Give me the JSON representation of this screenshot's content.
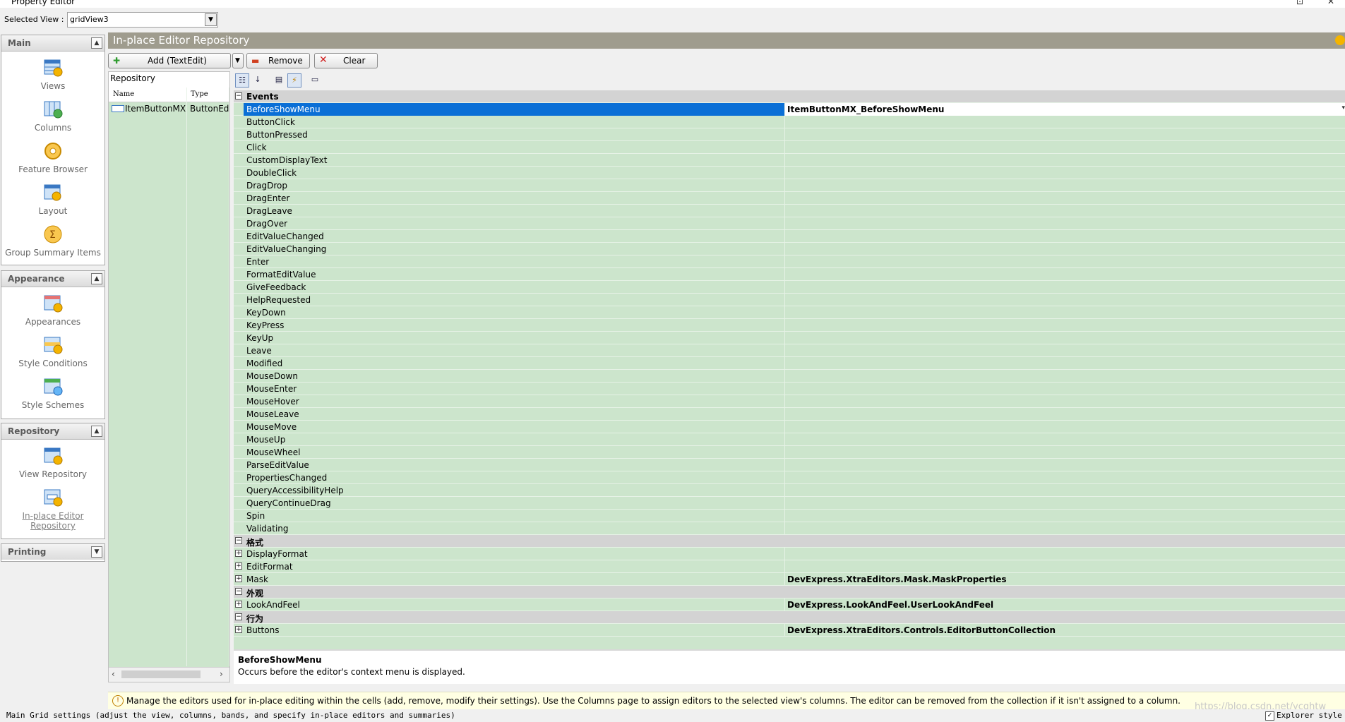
{
  "window": {
    "title": "Property Editor",
    "buttons": [
      "⊡",
      "✕"
    ]
  },
  "view_selector": {
    "label": "Selected View :",
    "value": "gridView3"
  },
  "nav": {
    "groups": [
      {
        "title": "Main",
        "items": [
          "Views",
          "Columns",
          "Feature Browser",
          "Layout",
          "Group Summary Items"
        ]
      },
      {
        "title": "Appearance",
        "items": [
          "Appearances",
          "Style Conditions",
          "Style Schemes"
        ]
      },
      {
        "title": "Repository",
        "items": [
          "View Repository",
          "In-place Editor",
          "Repository"
        ]
      },
      {
        "title": "Printing",
        "items": []
      }
    ]
  },
  "header": {
    "title": "In-place Editor Repository"
  },
  "toolbar": {
    "add_label": "Add (TextEdit)",
    "remove_label": "Remove",
    "clear_label": "Clear"
  },
  "repository": {
    "title": "Repository",
    "col_name": "Name",
    "col_type": "Type",
    "rows": [
      {
        "name": "ItemButtonMX",
        "type": "ButtonEdit"
      }
    ]
  },
  "grid": {
    "rows": [
      {
        "cat": true,
        "name": "Events"
      },
      {
        "name": "BeforeShowMenu",
        "value": "ItemButtonMX_BeforeShowMenu",
        "selected": true
      },
      {
        "name": "ButtonClick"
      },
      {
        "name": "ButtonPressed"
      },
      {
        "name": "Click"
      },
      {
        "name": "CustomDisplayText"
      },
      {
        "name": "DoubleClick"
      },
      {
        "name": "DragDrop"
      },
      {
        "name": "DragEnter"
      },
      {
        "name": "DragLeave"
      },
      {
        "name": "DragOver"
      },
      {
        "name": "EditValueChanged"
      },
      {
        "name": "EditValueChanging"
      },
      {
        "name": "Enter"
      },
      {
        "name": "FormatEditValue"
      },
      {
        "name": "GiveFeedback"
      },
      {
        "name": "HelpRequested"
      },
      {
        "name": "KeyDown"
      },
      {
        "name": "KeyPress"
      },
      {
        "name": "KeyUp"
      },
      {
        "name": "Leave"
      },
      {
        "name": "Modified"
      },
      {
        "name": "MouseDown"
      },
      {
        "name": "MouseEnter"
      },
      {
        "name": "MouseHover"
      },
      {
        "name": "MouseLeave"
      },
      {
        "name": "MouseMove"
      },
      {
        "name": "MouseUp"
      },
      {
        "name": "MouseWheel"
      },
      {
        "name": "ParseEditValue"
      },
      {
        "name": "PropertiesChanged"
      },
      {
        "name": "QueryAccessibilityHelp"
      },
      {
        "name": "QueryContinueDrag"
      },
      {
        "name": "Spin"
      },
      {
        "name": "Validating"
      },
      {
        "cat": true,
        "name": "格式"
      },
      {
        "name": "DisplayFormat",
        "expandable": true
      },
      {
        "name": "EditFormat",
        "expandable": true
      },
      {
        "name": "Mask",
        "expandable": true,
        "value": "DevExpress.XtraEditors.Mask.MaskProperties"
      },
      {
        "cat": true,
        "name": "外观"
      },
      {
        "name": "LookAndFeel",
        "expandable": true,
        "value": "DevExpress.LookAndFeel.UserLookAndFeel"
      },
      {
        "cat": true,
        "name": "行为"
      },
      {
        "name": "Buttons",
        "expandable": true,
        "value": "DevExpress.XtraEditors.Controls.EditorButtonCollection"
      }
    ]
  },
  "description": {
    "title": "BeforeShowMenu",
    "text": "Occurs before the editor's context menu is displayed."
  },
  "info": {
    "text": "Manage the editors used for in-place editing within the cells (add, remove, modify their settings). Use the Columns page to assign editors to the selected view's columns. The editor can be removed from the collection if it isn't assigned to a column."
  },
  "status": {
    "text": "Main Grid settings (adjust the view, columns, bands, and specify in-place editors and summaries)",
    "checkbox_label": "Explorer style",
    "checked": true
  },
  "watermark": "https://blog.csdn.net/ycqhtw"
}
